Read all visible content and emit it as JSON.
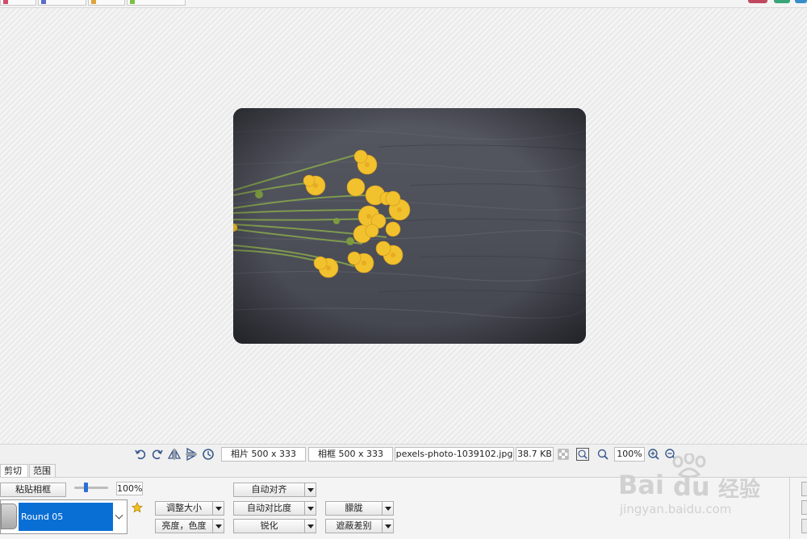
{
  "status": {
    "photo_size": "相片 500 x 333",
    "frame_size": "相框 500 x 333",
    "filename": "pexels-photo-1039102.jpg",
    "filesize": "38.7 KB",
    "zoom": "100%"
  },
  "tabs": [
    {
      "label": "剪切"
    },
    {
      "label": "范围"
    }
  ],
  "panel": {
    "paste_frame": "粘贴相框",
    "opacity": "100%",
    "frame_name": "Round 05",
    "resize": "调整大小",
    "brightness": "亮度，色度",
    "auto_align": "自动对齐",
    "auto_contrast": "自动对比度",
    "sharpen": "锐化",
    "blur": "朦胧",
    "mask_diff": "遮蔽差别"
  },
  "colors": {
    "selection_blue": "#0a6fd5",
    "flower_yellow": "#f2c12e",
    "wood_gray": "#4a4c55"
  },
  "watermark": {
    "brand": "Bai",
    "brand2": "du",
    "cn": "经验",
    "url": "jingyan.baidu.com"
  }
}
